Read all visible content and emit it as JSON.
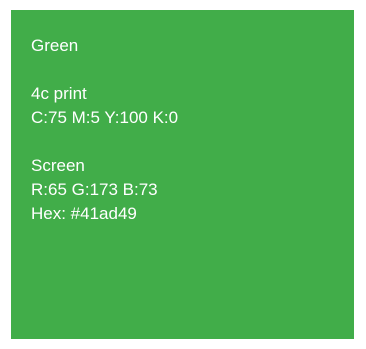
{
  "swatch": {
    "color": "#41ad49",
    "name": "Green",
    "print": {
      "label": "4c print",
      "value": "C:75 M:5 Y:100 K:0"
    },
    "screen": {
      "label": "Screen",
      "rgb": "R:65 G:173 B:73",
      "hex": "Hex: #41ad49"
    }
  }
}
